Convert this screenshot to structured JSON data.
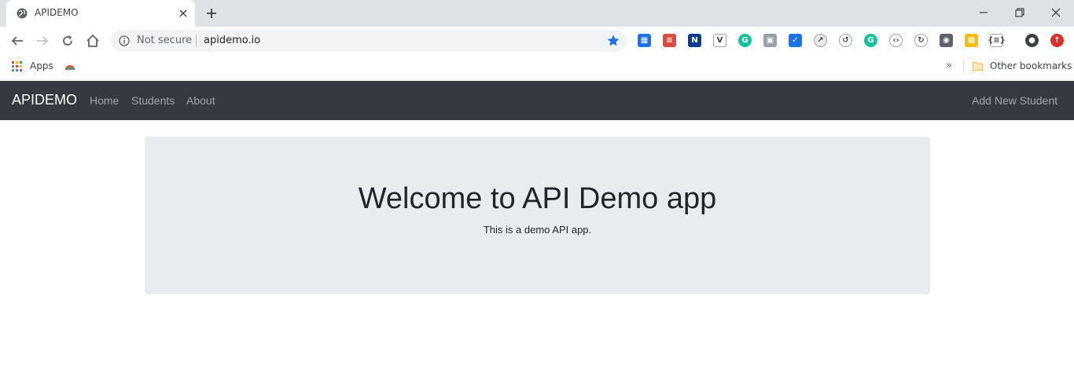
{
  "browser": {
    "tab": {
      "title": "APIDEMO",
      "favicon": "globe-icon"
    },
    "omnibox": {
      "security_label": "Not secure",
      "url": "apidemo.io"
    },
    "bookmarks": {
      "apps_label": "Apps",
      "other_label": "Other bookmarks",
      "overflow_label": "»"
    },
    "extensions": [
      {
        "name": "ext-tiles-icon",
        "color": "#1a73e8",
        "glyph": "▦"
      },
      {
        "name": "ext-todoist-icon",
        "color": "#db4c3f",
        "glyph": "≡"
      },
      {
        "name": "ext-news-icon",
        "color": "#0b3d91",
        "glyph": "N"
      },
      {
        "name": "ext-vee-icon",
        "color": "#ffffff",
        "glyph": "V"
      },
      {
        "name": "ext-grammarly-icon",
        "color": "#15c39a",
        "glyph": "G"
      },
      {
        "name": "ext-photo-icon",
        "color": "#9aa0a6",
        "glyph": "▣"
      },
      {
        "name": "ext-shield-icon",
        "color": "#1a73e8",
        "glyph": "✓"
      },
      {
        "name": "ext-pulse-icon",
        "color": "#e8eaed",
        "glyph": "↗"
      },
      {
        "name": "ext-history-icon",
        "color": "#ffffff",
        "glyph": "↺"
      },
      {
        "name": "ext-grammar-g-icon",
        "color": "#15c39a",
        "glyph": "G"
      },
      {
        "name": "ext-code-icon",
        "color": "#ffffff",
        "glyph": "‹›"
      },
      {
        "name": "ext-refresh-icon",
        "color": "#ffffff",
        "glyph": "↻"
      },
      {
        "name": "ext-bulb-icon",
        "color": "#5f6368",
        "glyph": "◉"
      },
      {
        "name": "ext-palette-icon",
        "color": "#fbbc04",
        "glyph": "▩"
      },
      {
        "name": "ext-json-icon",
        "color": "#ffffff",
        "glyph": "{≡}"
      },
      {
        "name": "profile-avatar-icon",
        "color": "#3c4043",
        "glyph": "●"
      },
      {
        "name": "ext-update-icon",
        "color": "#d93025",
        "glyph": "↑"
      }
    ]
  },
  "navbar": {
    "brand": "APIDEMO",
    "links": [
      "Home",
      "Students",
      "About"
    ],
    "right_link": "Add New Student"
  },
  "jumbotron": {
    "title": "Welcome to API Demo app",
    "text": "This is a demo API app."
  }
}
